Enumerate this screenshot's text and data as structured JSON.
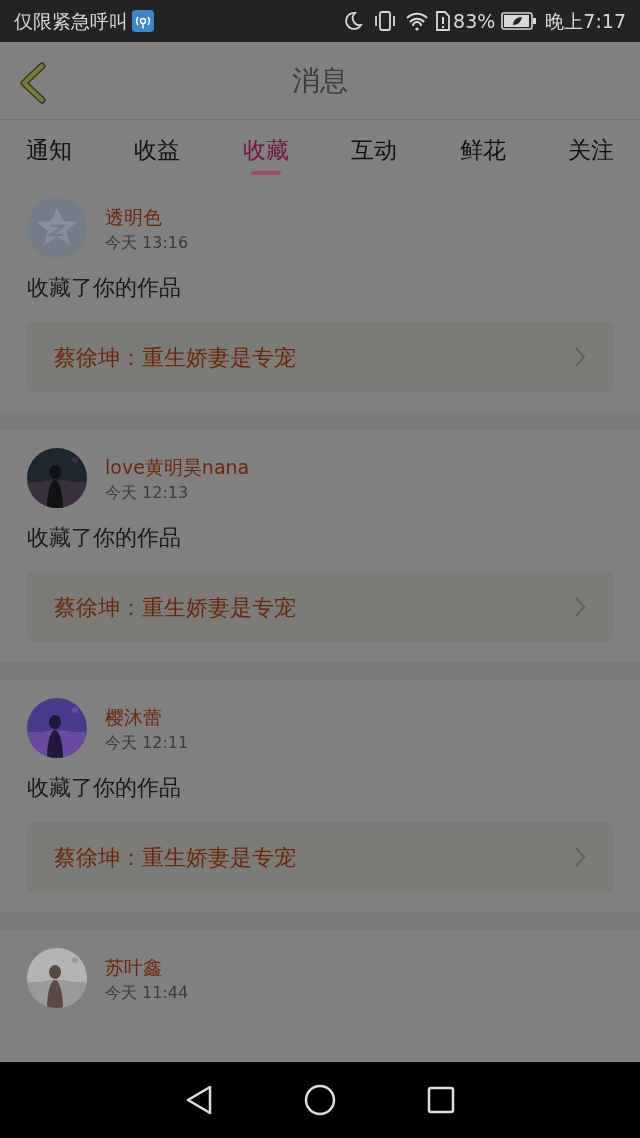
{
  "status_bar": {
    "carrier": "仅限紧急呼叫",
    "battery": "83%",
    "time": "晚上7:17"
  },
  "header": {
    "title": "消息"
  },
  "tabs": [
    {
      "label": "通知",
      "selected": false
    },
    {
      "label": "收益",
      "selected": false
    },
    {
      "label": "收藏",
      "selected": true
    },
    {
      "label": "互动",
      "selected": false
    },
    {
      "label": "鲜花",
      "selected": false
    },
    {
      "label": "关注",
      "selected": false
    }
  ],
  "messages": [
    {
      "avatar": {
        "kind": "default"
      },
      "name": "透明色",
      "time": "今天 13:16",
      "text": "收藏了你的作品",
      "work": "蔡徐坤：重生娇妻是专宠"
    },
    {
      "name": "love黄明昊nana",
      "time": "今天 12:13",
      "text": "收藏了你的作品",
      "work": "蔡徐坤：重生娇妻是专宠"
    },
    {
      "name": "樱沐蕾",
      "time": "今天 12:11",
      "text": "收藏了你的作品",
      "work": "蔡徐坤：重生娇妻是专宠"
    },
    {
      "name": "苏叶鑫",
      "time": "今天 11:44"
    }
  ]
}
